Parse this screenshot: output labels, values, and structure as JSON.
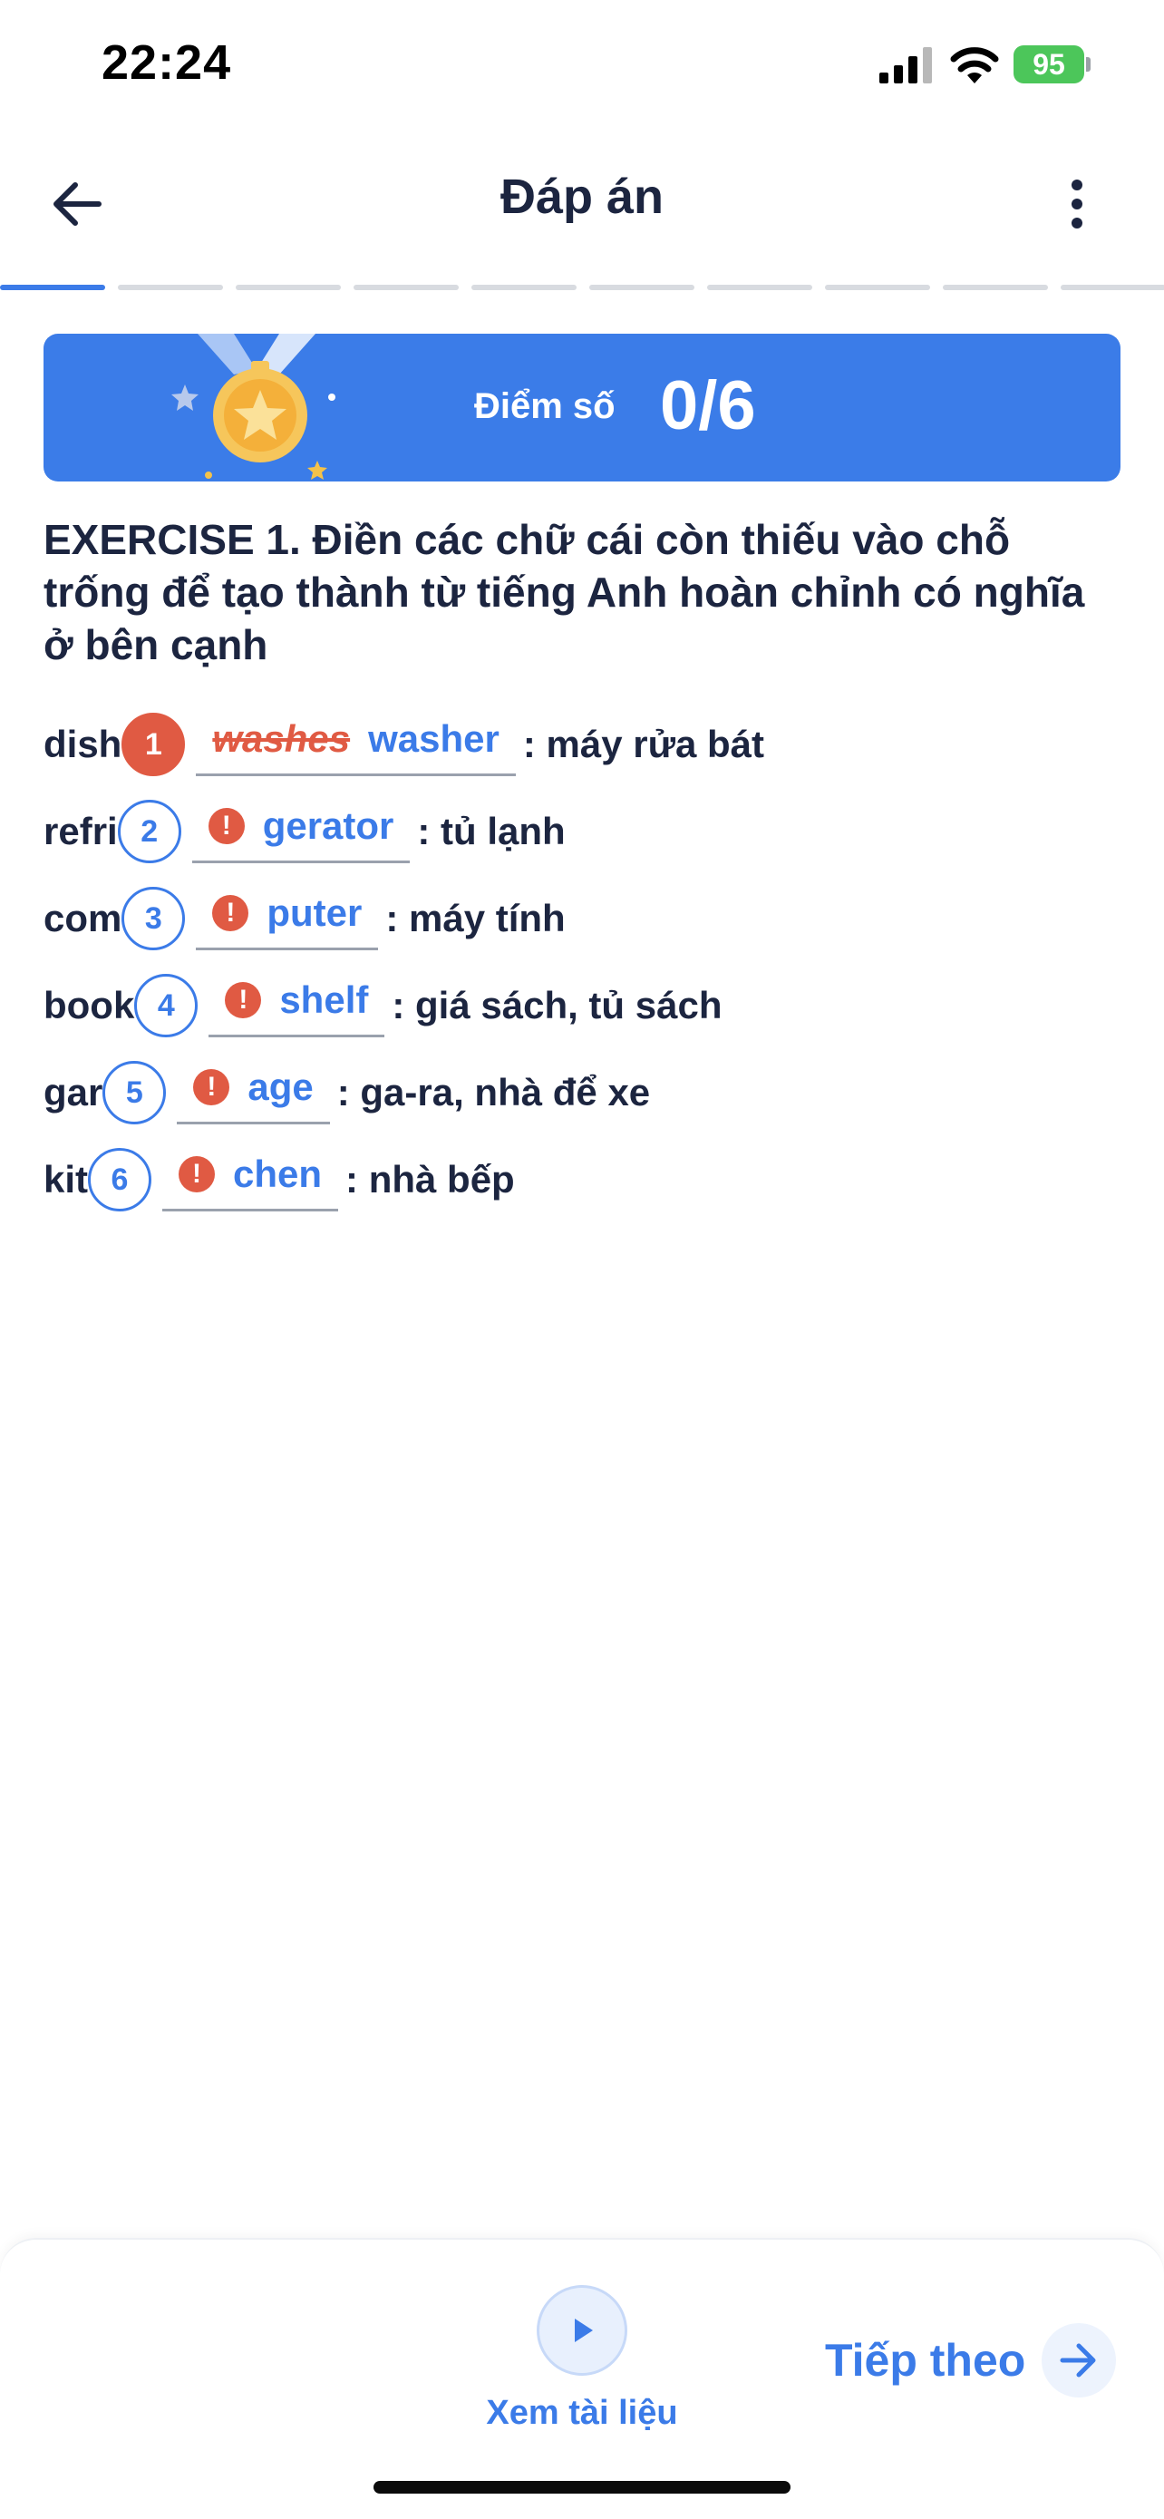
{
  "status_bar": {
    "time": "22:24",
    "battery": "95"
  },
  "header": {
    "title": "Đáp án"
  },
  "progress": {
    "total_segments": 10,
    "current_segment": 1
  },
  "score": {
    "label": "Điểm số",
    "value": "0/6"
  },
  "exercise": {
    "heading": "EXERCISE 1. Điền các chữ cái còn thiếu vào chỗ trống để tạo thành từ tiếng Anh hoàn chỉnh có nghĩa ở bên cạnh"
  },
  "questions": [
    {
      "prefix": "dish",
      "number": "1",
      "user_answer": "washes",
      "correct_answer": "washer",
      "meaning": ": máy rửa bát",
      "status": "wrong"
    },
    {
      "prefix": "refri",
      "number": "2",
      "user_answer": "",
      "correct_answer": "gerator",
      "meaning": ": tủ lạnh",
      "status": "unanswered"
    },
    {
      "prefix": "com",
      "number": "3",
      "user_answer": "",
      "correct_answer": "puter",
      "meaning": ": máy tính",
      "status": "unanswered"
    },
    {
      "prefix": "book",
      "number": "4",
      "user_answer": "",
      "correct_answer": "shelf",
      "meaning": ": giá sách, tủ sách",
      "status": "unanswered"
    },
    {
      "prefix": "gar",
      "number": "5",
      "user_answer": "",
      "correct_answer": "age",
      "meaning": ": ga-ra, nhà để xe",
      "status": "unanswered"
    },
    {
      "prefix": "kit",
      "number": "6",
      "user_answer": "",
      "correct_answer": "chen",
      "meaning": ": nhà bếp",
      "status": "unanswered"
    }
  ],
  "bottom_bar": {
    "view_doc_label": "Xem tài liệu",
    "next_label": "Tiếp theo"
  },
  "icons": {
    "back": "arrow-left-icon",
    "more": "more-vertical-icon",
    "medal": "medal-icon",
    "alert": "alert-icon",
    "play": "play-icon",
    "next": "arrow-right-icon"
  },
  "colors": {
    "accent": "#3b7be8",
    "error": "#e05a43",
    "text": "#1c2540",
    "battery": "#4cc65a"
  }
}
